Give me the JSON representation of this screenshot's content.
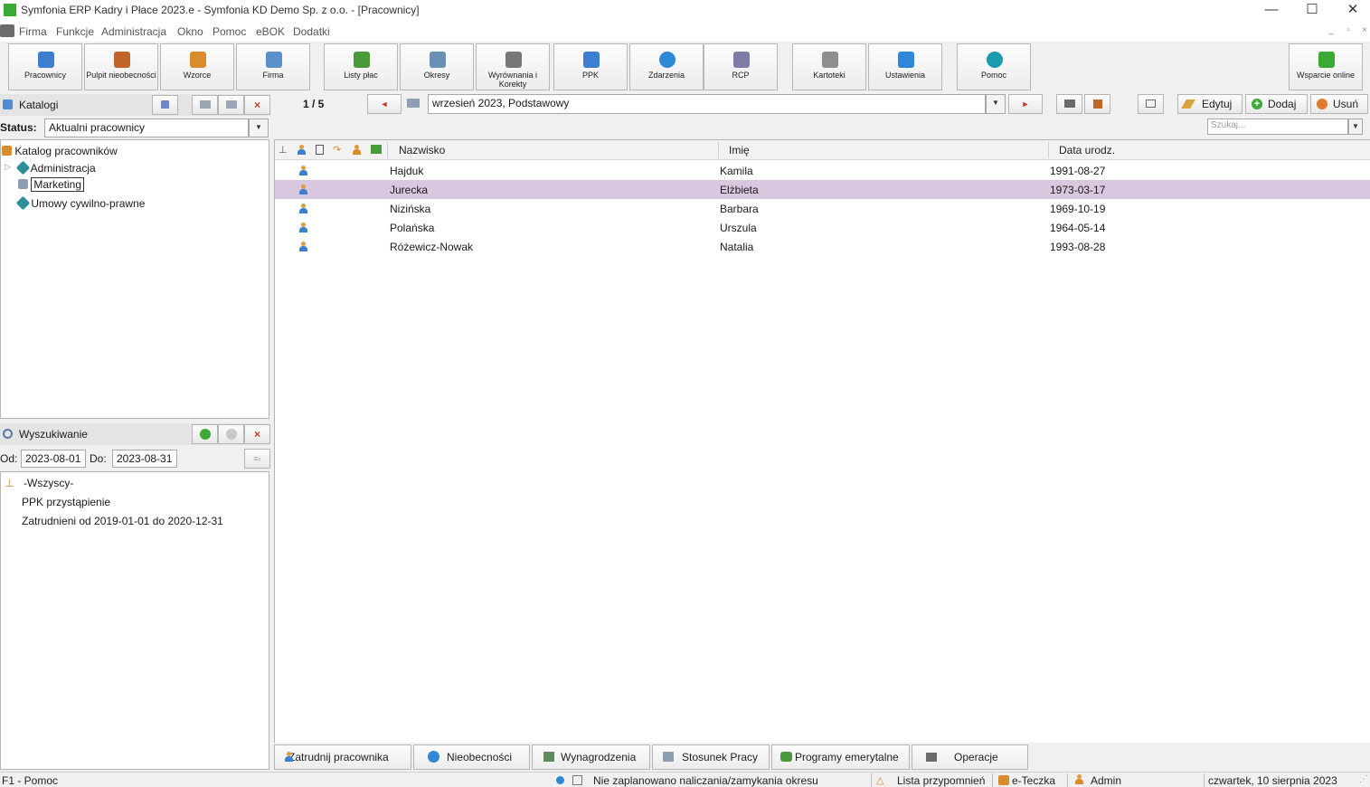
{
  "window": {
    "title": "Symfonia ERP Kadry i Płace 2023.e - Symfonia KD Demo Sp. z o.o. - [Pracownicy]",
    "minimize": "—",
    "maximize": "☐",
    "close": "✕"
  },
  "menu": {
    "items": [
      "Firma",
      "Funkcje",
      "Administracja",
      "Okno",
      "Pomoc",
      "eBOK",
      "Dodatki"
    ],
    "mdi_min": "_",
    "mdi_restore": "▫",
    "mdi_close": "×"
  },
  "toolbar": {
    "buttons": [
      {
        "label": "Pracownicy",
        "icon": "employee-icon",
        "color": "#3c7fd1"
      },
      {
        "label": "Pulpit nieobecności",
        "icon": "calendar-icon",
        "color": "#c0662a"
      },
      {
        "label": "Wzorce",
        "icon": "templates-icon",
        "color": "#d98c2b"
      },
      {
        "label": "Firma",
        "icon": "company-icon",
        "color": "#5b8fc9"
      },
      {
        "label": "Listy płac",
        "icon": "payroll-icon",
        "color": "#4a9a3a"
      },
      {
        "label": "Okresy",
        "icon": "periods-icon",
        "color": "#6a8fb5"
      },
      {
        "label": "Wyrównania i Korekty",
        "icon": "adjustments-icon",
        "color": "#777777"
      },
      {
        "label": "PPK",
        "icon": "ppk-chart-icon",
        "color": "#3c7fd1"
      },
      {
        "label": "Zdarzenia",
        "icon": "events-globe-icon",
        "color": "#2f87d8"
      },
      {
        "label": "RCP",
        "icon": "rcp-icon",
        "color": "#7d7da8"
      },
      {
        "label": "Kartoteki",
        "icon": "registers-icon",
        "color": "#8f8f8f"
      },
      {
        "label": "Ustawienia",
        "icon": "settings-tools-icon",
        "color": "#2f87d8"
      },
      {
        "label": "Pomoc",
        "icon": "help-icon",
        "color": "#1a9bb0"
      },
      {
        "label": "Wsparcie online",
        "icon": "online-support-icon",
        "color": "#3aa935"
      }
    ]
  },
  "catalogs": {
    "title": "Katalogi",
    "status_label": "Status:",
    "status_value": "Aktualni pracownicy",
    "tree": [
      {
        "label": "Katalog pracowników"
      },
      {
        "label": "Administracja"
      },
      {
        "label": "Marketing"
      },
      {
        "label": "Umowy cywilno-prawne"
      }
    ],
    "close_glyph": "×"
  },
  "navigation": {
    "counter": "1 / 5",
    "prev": "◄",
    "next": "►",
    "period": "wrzesień 2023, Podstawowy",
    "dd": "▼"
  },
  "actions": {
    "edit": "Edytuj",
    "add": "Dodaj",
    "delete": "Usuń",
    "search_placeholder": "Szukaj..."
  },
  "table": {
    "columns": [
      "Nazwisko",
      "Imię",
      "Data urodz."
    ],
    "rows": [
      {
        "nazwisko": "Hajduk",
        "imie": "Kamila",
        "data": "1991-08-27"
      },
      {
        "nazwisko": "Jurecka",
        "imie": "Elżbieta",
        "data": "1973-03-17"
      },
      {
        "nazwisko": "Nizińska",
        "imie": "Barbara",
        "data": "1969-10-19"
      },
      {
        "nazwisko": "Polańska",
        "imie": "Urszula",
        "data": "1964-05-14"
      },
      {
        "nazwisko": "Różewicz-Nowak",
        "imie": "Natalia",
        "data": "1993-08-28"
      }
    ],
    "selected_row": 1,
    "selection_color": "#d9c6df"
  },
  "search_panel": {
    "title": "Wyszukiwanie",
    "from_label": "Od:",
    "from_value": "2023-08-01",
    "to_label": "Do:",
    "to_value": "2023-08-31",
    "items": [
      "-Wszyscy-",
      "PPK przystąpienie",
      "Zatrudnieni od 2019-01-01 do 2020-12-31"
    ],
    "close_glyph": "×"
  },
  "bottom_tabs": [
    {
      "label": "Zatrudnij pracownika",
      "icon": "hire-icon"
    },
    {
      "label": "Nieobecności",
      "icon": "info-icon"
    },
    {
      "label": "Wynagrodzenia",
      "icon": "salary-icon"
    },
    {
      "label": "Stosunek Pracy",
      "icon": "contract-icon"
    },
    {
      "label": "Programy emerytalne",
      "icon": "pension-icon"
    },
    {
      "label": "Operacje",
      "icon": "print-icon"
    }
  ],
  "statusbar": {
    "help": "F1 - Pomoc",
    "period_status": "Nie zaplanowano naliczania/zamykania okresu",
    "reminders": "Lista przypomnień",
    "eteczka": "e-Teczka",
    "user": "Admin",
    "date": "czwartek, 10 sierpnia 2023"
  }
}
